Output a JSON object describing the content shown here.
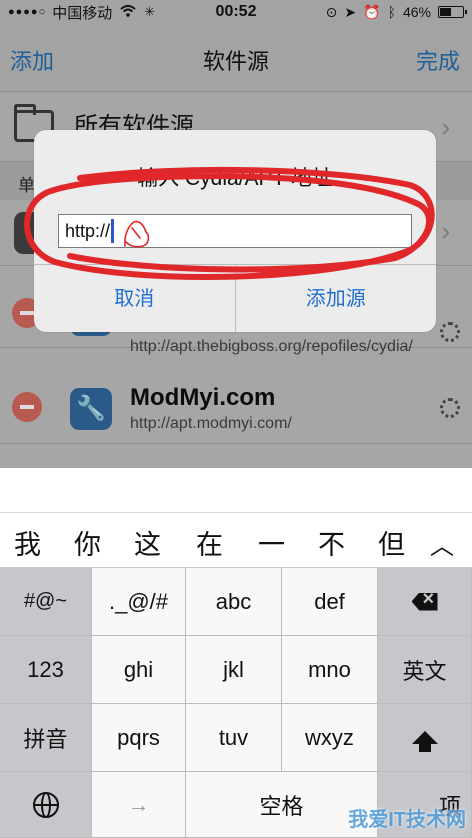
{
  "status_bar": {
    "signal": "●●●●○",
    "carrier": "中国移动",
    "wifi_icon": "wifi-icon",
    "activity_icon": "activity-spinner-icon",
    "time": "00:52",
    "battery_percent": "46%"
  },
  "nav": {
    "left": "添加",
    "title": "软件源",
    "right": "完成"
  },
  "list": {
    "all_sources": "所有软件源",
    "section_header": "单",
    "sources": [
      {
        "name": "",
        "url": "http://apt.thebigboss.org/repofiles/cydia/"
      },
      {
        "name": "ModMyi.com",
        "url": "http://apt.modmyi.com/"
      }
    ]
  },
  "alert": {
    "title": "输入 Cydia/APT 地址",
    "input_value": "http://",
    "cancel": "取消",
    "add": "添加源"
  },
  "candidates": [
    "我",
    "你",
    "这",
    "在",
    "一",
    "不",
    "但"
  ],
  "keyboard": {
    "row1": [
      "#@~",
      "._@/#",
      "abc",
      "def"
    ],
    "row2": [
      "123",
      "ghi",
      "jkl",
      "mno",
      "英文"
    ],
    "row3": [
      "拼音",
      "pqrs",
      "tuv",
      "wxyz"
    ],
    "row4": [
      "→",
      "空格",
      "项"
    ],
    "expand": "^"
  },
  "watermark": "我爱IT技术网",
  "colors": {
    "accent": "#1f6fd0",
    "annotation": "#e0282b"
  }
}
